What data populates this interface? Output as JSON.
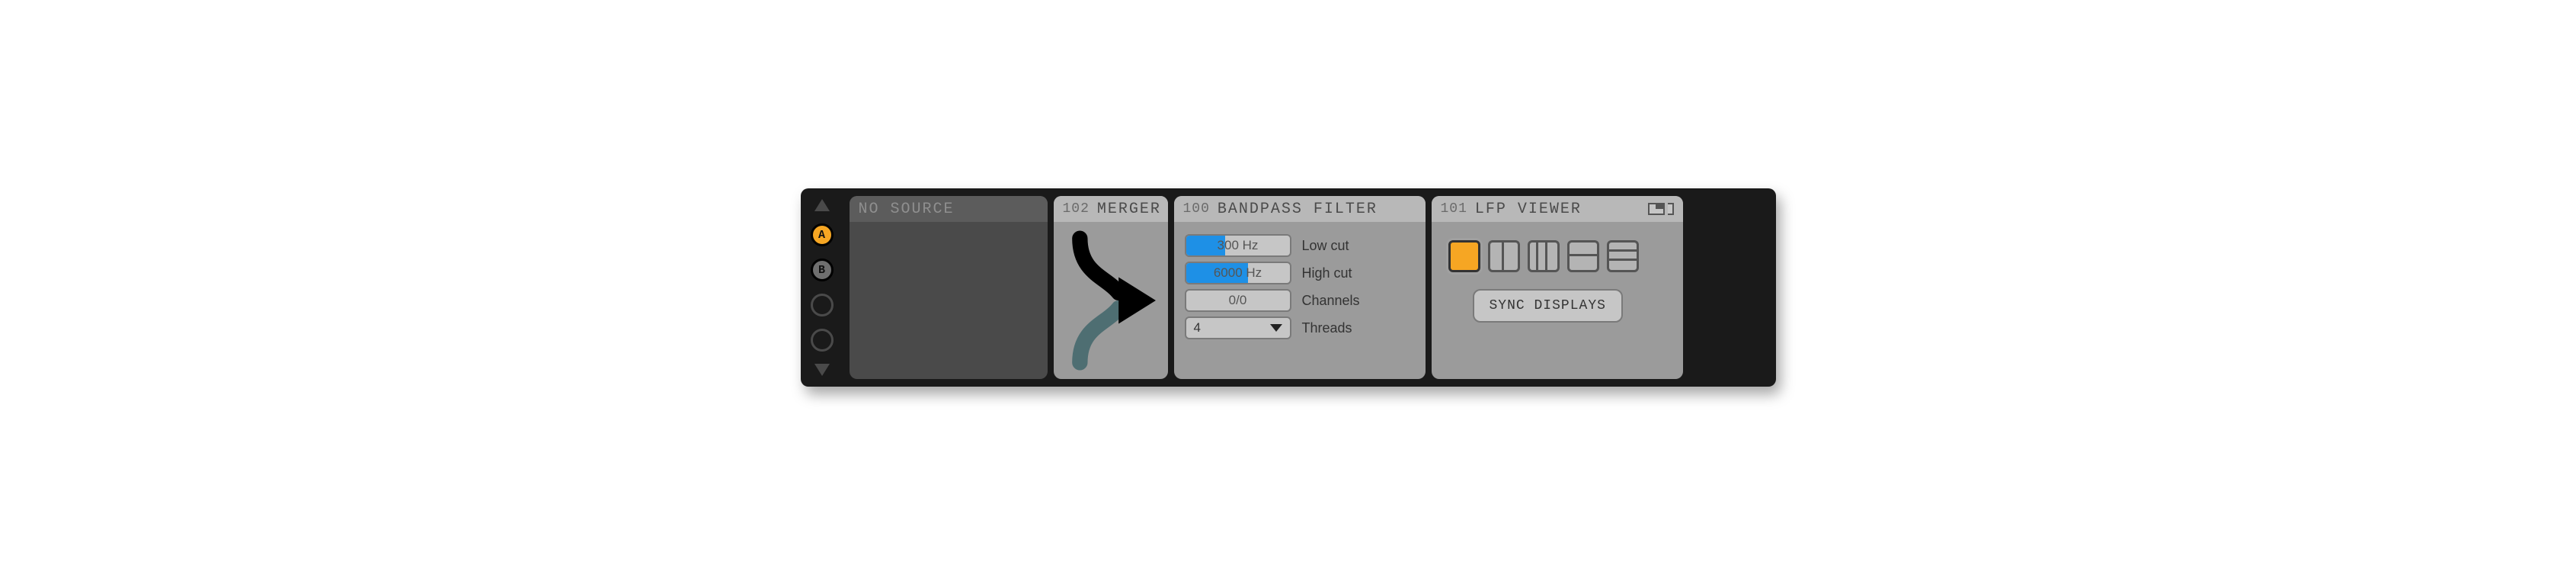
{
  "nav": {
    "a_label": "A",
    "b_label": "B"
  },
  "no_source": {
    "title": "NO SOURCE"
  },
  "merger": {
    "id": "102",
    "title": "MERGER"
  },
  "bandpass": {
    "id": "100",
    "title": "BANDPASS FILTER",
    "low_cut": {
      "value": "300",
      "unit": "Hz",
      "label": "Low cut",
      "fill_pct": 38
    },
    "high_cut": {
      "value": "6000",
      "unit": "Hz",
      "label": "High cut",
      "fill_pct": 60
    },
    "channels": {
      "value": "0/0",
      "label": "Channels"
    },
    "threads": {
      "value": "4",
      "label": "Threads"
    }
  },
  "lfp": {
    "id": "101",
    "title": "LFP VIEWER",
    "sync_label": "SYNC DISPLAYS"
  }
}
